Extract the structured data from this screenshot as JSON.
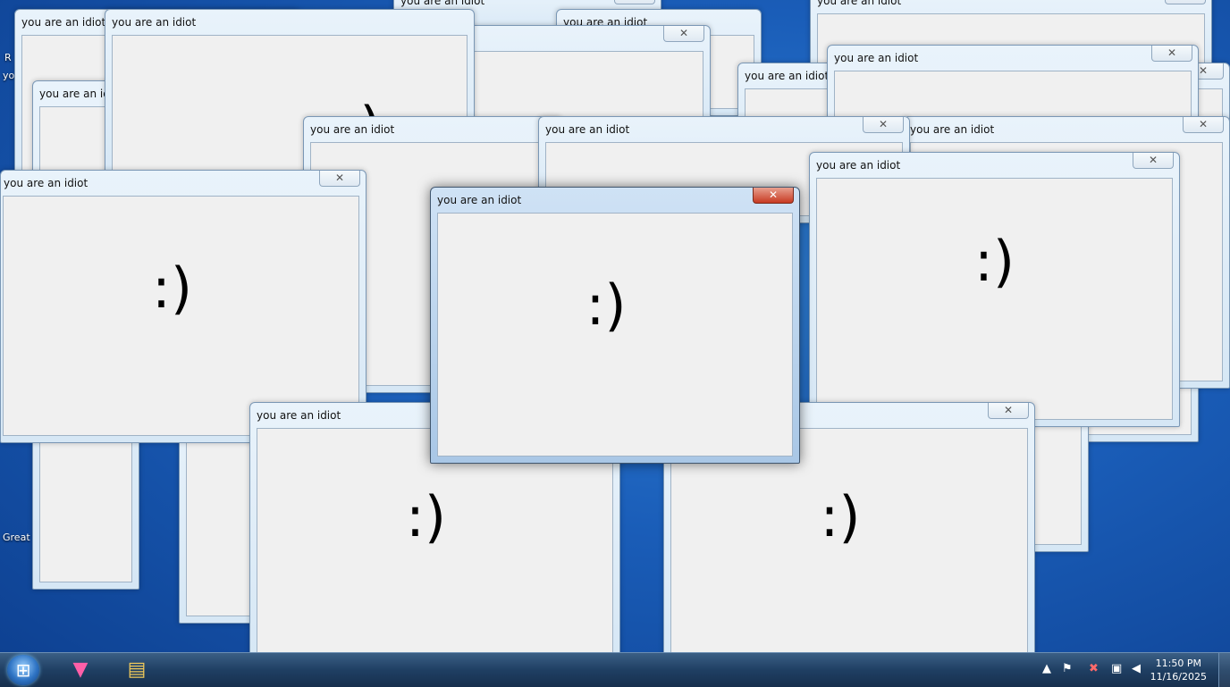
{
  "window_title": "you are an idiot",
  "close_glyph": "✕",
  "smiley": ":)",
  "desktop_labels": [
    "R",
    "yo",
    "Great"
  ],
  "taskbar": {
    "start_icon": "windows-orb-icon",
    "apps": [
      "cat-app-icon",
      "folder-explorer-icon"
    ],
    "tray": {
      "time": "11:50 PM",
      "date": "11/16/2025"
    }
  },
  "colors": {
    "desktop": "#1a5db8",
    "client": "#f0f0f0",
    "close_active": "#c73a22"
  }
}
